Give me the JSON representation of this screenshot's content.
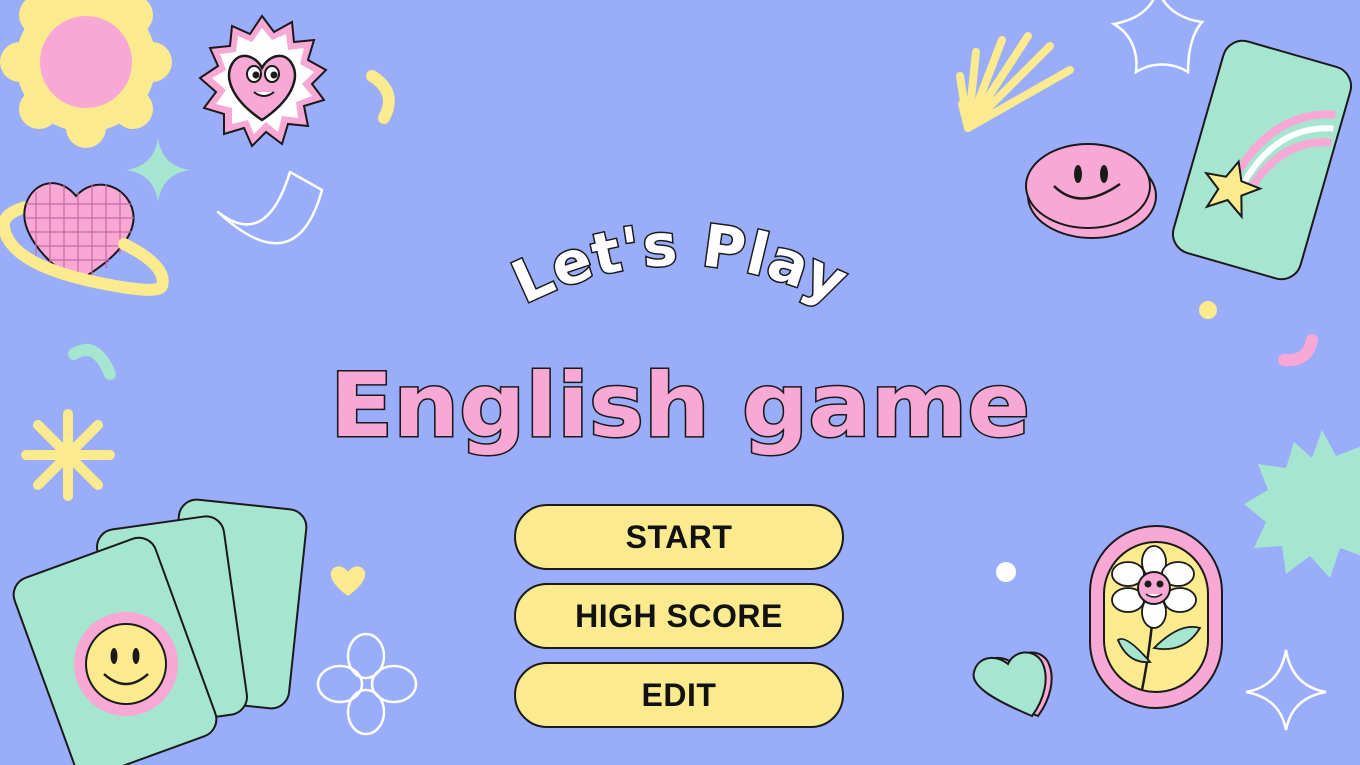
{
  "title": {
    "line1": "Let's Play",
    "line2": "English game"
  },
  "menu": {
    "start": "START",
    "high_score": "HIGH SCORE",
    "edit": "EDIT"
  },
  "colors": {
    "background": "#9aadfa",
    "button_fill": "#fbea8e",
    "title_pink": "#f7a8d4",
    "mint": "#a6e5cf",
    "yellow": "#fbea8e",
    "outline": "#1a1a1a"
  },
  "decorations": [
    "sun-icon",
    "heart-face-badge-icon",
    "sparkle-icon",
    "planet-heart-icon",
    "star-outline-icon",
    "sunburst-icon",
    "smiley-coin-icon",
    "shooting-star-card-icon",
    "asterisk-icon",
    "playing-cards-icon",
    "flower-outline-icon",
    "flower-card-icon",
    "heart-icon",
    "splat-icon",
    "four-point-star-icon"
  ]
}
